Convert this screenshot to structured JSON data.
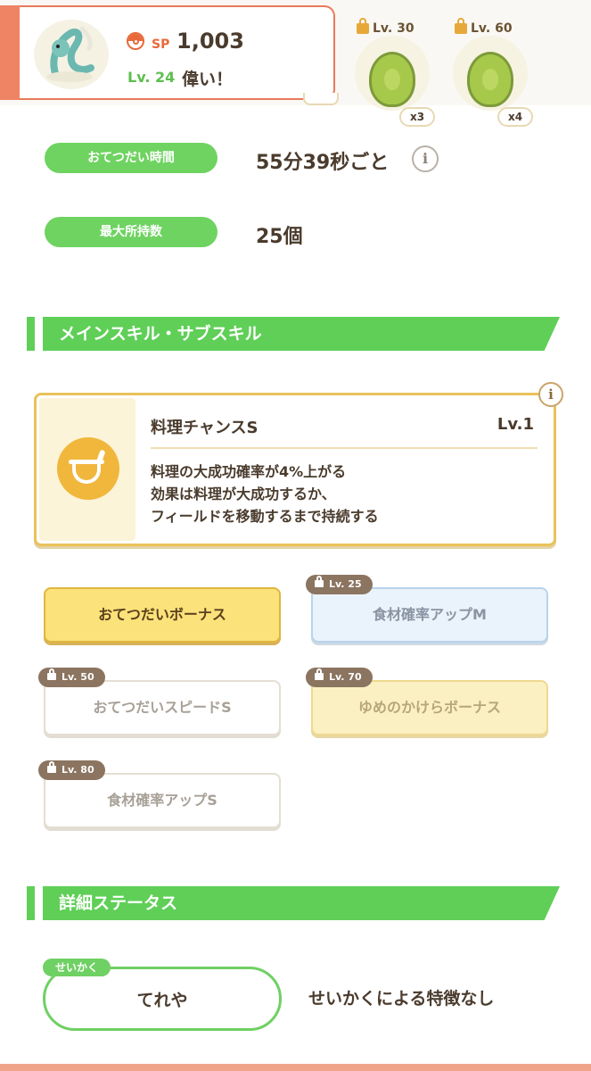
{
  "header": {
    "sp_label": "SP",
    "sp_value": "1,003",
    "level": "Lv. 24",
    "title": "偉い！"
  },
  "ingredients": [
    {
      "level": "Lv. 30",
      "count": "x3",
      "icon": "avocado-icon"
    },
    {
      "level": "Lv. 60",
      "count": "x4",
      "icon": "avocado-icon"
    }
  ],
  "info": {
    "help_time_label": "おてつだい時間",
    "help_time_value": "55分39秒ごと",
    "max_carry_label": "最大所持数",
    "max_carry_value": "25個",
    "info_glyph": "i"
  },
  "skills_section": {
    "title": "メインスキル・サブスキル"
  },
  "main_skill": {
    "name": "料理チャンスS",
    "level": "Lv.1",
    "desc_line1": "料理の大成功確率が4%上がる",
    "desc_line2": "効果は料理が大成功するか、",
    "desc_line3": "フィールドを移動するまで持続する"
  },
  "subskills": [
    {
      "name": "おてつだいボーナス",
      "level": "",
      "state": "active"
    },
    {
      "name": "食材確率アップM",
      "level": "Lv. 25",
      "state": "locked"
    },
    {
      "name": "おてつだいスピードS",
      "level": "Lv. 50",
      "state": "locked"
    },
    {
      "name": "ゆめのかけらボーナス",
      "level": "Lv. 70",
      "state": "locked"
    },
    {
      "name": "食材確率アップS",
      "level": "Lv. 80",
      "state": "locked"
    }
  ],
  "details_section": {
    "title": "詳細ステータス"
  },
  "nature": {
    "tag": "せいかく",
    "name": "てれや",
    "description": "せいかくによる特徴なし"
  },
  "colors": {
    "accent_green": "#5fcf57",
    "skill_gold": "#e9c25a",
    "sp_orange": "#e86a3a"
  }
}
